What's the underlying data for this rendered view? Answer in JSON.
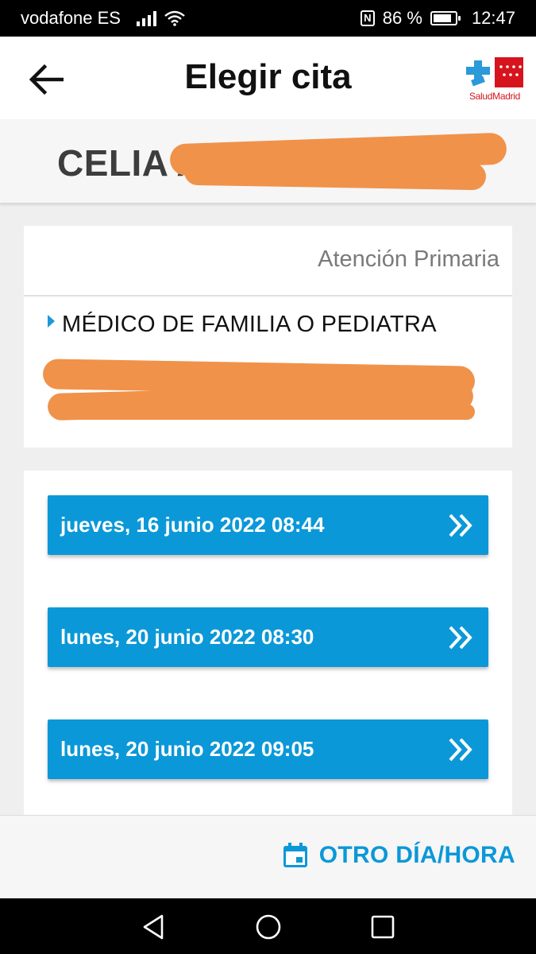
{
  "status_bar": {
    "carrier": "vodafone ES",
    "battery_percent": "86 %",
    "battery_level": 0.86,
    "time": "12:47",
    "nfc_label": "N"
  },
  "header": {
    "title": "Elegir cita",
    "logo_text": "SaludMadrid"
  },
  "patient": {
    "name_visible": "CELIA A"
  },
  "info": {
    "service": "Atención Primaria",
    "specialty": "MÉDICO DE FAMILIA O PEDIATRA"
  },
  "slots": [
    {
      "label": "jueves, 16 junio 2022 08:44"
    },
    {
      "label": "lunes, 20 junio 2022 08:30"
    },
    {
      "label": "lunes, 20 junio 2022 09:05"
    }
  ],
  "footer": {
    "other_label": "OTRO DÍA/HORA"
  },
  "colors": {
    "accent": "#0b98d8",
    "redaction": "#f0924a",
    "logo_red": "#d6141e"
  }
}
